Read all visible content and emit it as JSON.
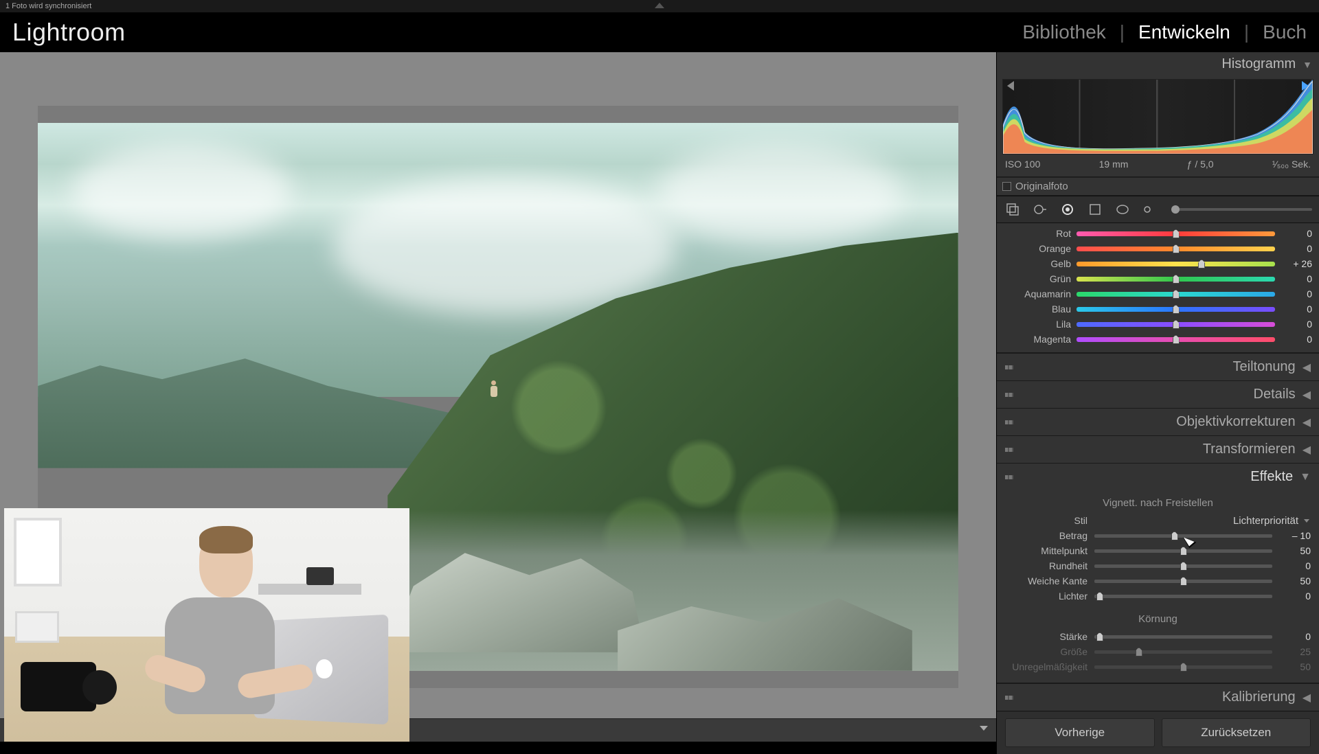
{
  "topbar": {
    "sync_status": "1 Foto wird synchronisiert"
  },
  "header": {
    "logo": "Lightroom",
    "modules": {
      "library": "Bibliothek",
      "develop": "Entwickeln",
      "book": "Buch"
    }
  },
  "histogram": {
    "title": "Histogramm",
    "iso": "ISO 100",
    "focal": "19 mm",
    "aperture": "ƒ / 5,0",
    "shutter": "¹⁄₅₀₀ Sek.",
    "original_label": "Originalfoto"
  },
  "colors": {
    "rows": [
      {
        "label": "Rot",
        "value": "0",
        "pos": 50,
        "grad": [
          "#ff5bb0",
          "#ff3b3b",
          "#ff9a3b"
        ]
      },
      {
        "label": "Orange",
        "value": "0",
        "pos": 50,
        "grad": [
          "#ff4d4d",
          "#ff8a2b",
          "#ffd24d"
        ]
      },
      {
        "label": "Gelb",
        "value": "+ 26",
        "pos": 63,
        "grad": [
          "#ff9a2b",
          "#ffe24d",
          "#a8e24d"
        ]
      },
      {
        "label": "Grün",
        "value": "0",
        "pos": 50,
        "grad": [
          "#d8e24d",
          "#30c74d",
          "#2bd8b0"
        ]
      },
      {
        "label": "Aquamarin",
        "value": "0",
        "pos": 50,
        "grad": [
          "#2bd86a",
          "#2bd8d0",
          "#2ba8e8"
        ]
      },
      {
        "label": "Blau",
        "value": "0",
        "pos": 50,
        "grad": [
          "#2bc8e8",
          "#2b76ff",
          "#7a4dff"
        ]
      },
      {
        "label": "Lila",
        "value": "0",
        "pos": 50,
        "grad": [
          "#4d6aff",
          "#8a4dff",
          "#d84dd8"
        ]
      },
      {
        "label": "Magenta",
        "value": "0",
        "pos": 50,
        "grad": [
          "#b04dff",
          "#e84db0",
          "#ff4d6a"
        ]
      }
    ]
  },
  "sections": {
    "teiltonung": "Teiltonung",
    "details": "Details",
    "objektiv": "Objektivkorrekturen",
    "transform": "Transformieren",
    "effekte": "Effekte",
    "kalibrierung": "Kalibrierung"
  },
  "effekte": {
    "vignette_title": "Vignett. nach Freistellen",
    "stil_label": "Stil",
    "stil_value": "Lichterpriorität",
    "rows": [
      {
        "label": "Betrag",
        "value": "– 10",
        "pos": 45,
        "dim": false
      },
      {
        "label": "Mittelpunkt",
        "value": "50",
        "pos": 50,
        "dim": false
      },
      {
        "label": "Rundheit",
        "value": "0",
        "pos": 50,
        "dim": false
      },
      {
        "label": "Weiche Kante",
        "value": "50",
        "pos": 50,
        "dim": false
      },
      {
        "label": "Lichter",
        "value": "0",
        "pos": 3,
        "dim": false
      }
    ],
    "grain_title": "Körnung",
    "grain_rows": [
      {
        "label": "Stärke",
        "value": "0",
        "pos": 3,
        "dim": false
      },
      {
        "label": "Größe",
        "value": "25",
        "pos": 25,
        "dim": true
      },
      {
        "label": "Unregelmäßigkeit",
        "value": "50",
        "pos": 50,
        "dim": true
      }
    ]
  },
  "buttons": {
    "previous": "Vorherige",
    "reset": "Zurücksetzen"
  }
}
